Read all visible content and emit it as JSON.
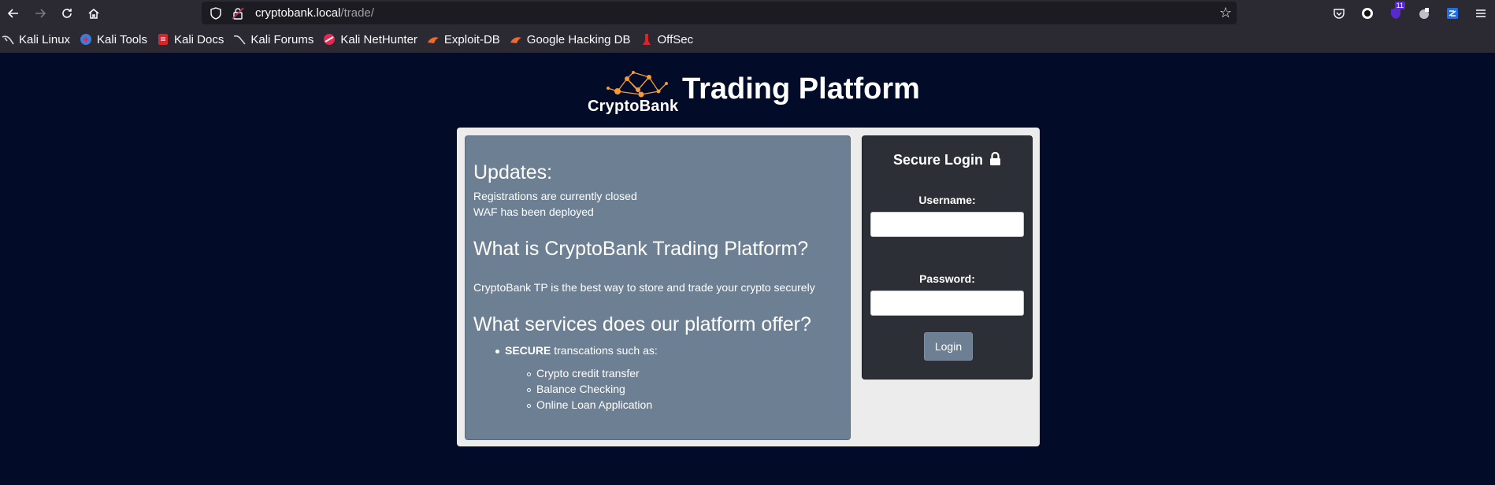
{
  "browser": {
    "url_host": "cryptobank.local",
    "url_path": "/trade/",
    "extension_badge": "11"
  },
  "bookmarks": [
    {
      "label": "Kali Linux",
      "icon": "kali-dragon-icon"
    },
    {
      "label": "Kali Tools",
      "icon": "kali-tools-icon"
    },
    {
      "label": "Kali Docs",
      "icon": "kali-docs-icon"
    },
    {
      "label": "Kali Forums",
      "icon": "kali-forums-icon"
    },
    {
      "label": "Kali NetHunter",
      "icon": "nethunter-icon"
    },
    {
      "label": "Exploit-DB",
      "icon": "exploit-db-icon"
    },
    {
      "label": "Google Hacking DB",
      "icon": "ghdb-icon"
    },
    {
      "label": "OffSec",
      "icon": "offsec-icon"
    }
  ],
  "header": {
    "logo_text": "CryptoBank",
    "title": "Trading Platform"
  },
  "info": {
    "updates_heading": "Updates:",
    "updates": [
      "Registrations are currently closed",
      "WAF has been deployed"
    ],
    "what_heading": "What is CryptoBank Trading Platform?",
    "what_text": "CryptoBank TP is the best way to store and trade your crypto securely",
    "services_heading": "What services does our platform offer?",
    "services_bold": "SECURE",
    "services_rest": " transcations such as:",
    "services_items": [
      "Crypto credit transfer",
      "Balance Checking",
      "Online Loan Application"
    ]
  },
  "login": {
    "title": "Secure Login",
    "username_label": "Username:",
    "username_value": "",
    "password_label": "Password:",
    "password_value": "",
    "button_label": "Login"
  },
  "colors": {
    "page_bg": "#020b27",
    "info_bg": "#6d7f92",
    "login_bg": "#2c3036",
    "logo_accent": "#f39a3a"
  }
}
